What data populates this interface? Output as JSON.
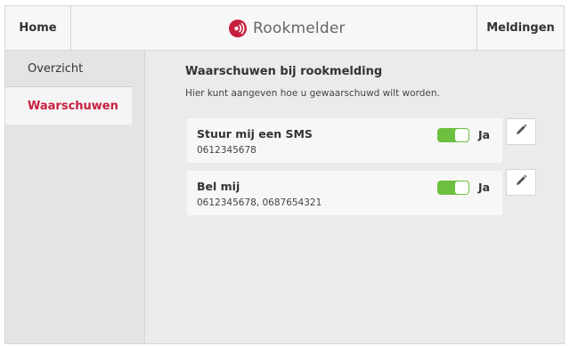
{
  "header": {
    "home_label": "Home",
    "title": "Rookmelder",
    "notifications_label": "Meldingen",
    "logo_icon": "smoke-alarm-icon",
    "brand_color": "#c7203f"
  },
  "sidebar": {
    "items": [
      {
        "label": "Overzicht",
        "active": false
      },
      {
        "label": "Waarschuwen",
        "active": true
      }
    ]
  },
  "main": {
    "title": "Waarschuwen bij rookmelding",
    "description": "Hier kunt aangeven hoe u gewaarschuwd wilt worden.",
    "options": [
      {
        "title": "Stuur mij een SMS",
        "detail": "0612345678",
        "enabled": true,
        "toggle_label": "Ja",
        "edit_icon": "pencil-icon"
      },
      {
        "title": "Bel mij",
        "detail": "0612345678, 0687654321",
        "enabled": true,
        "toggle_label": "Ja",
        "edit_icon": "pencil-icon"
      }
    ]
  },
  "colors": {
    "toggle_on": "#6cbf3f",
    "active_text": "#c7203f"
  }
}
